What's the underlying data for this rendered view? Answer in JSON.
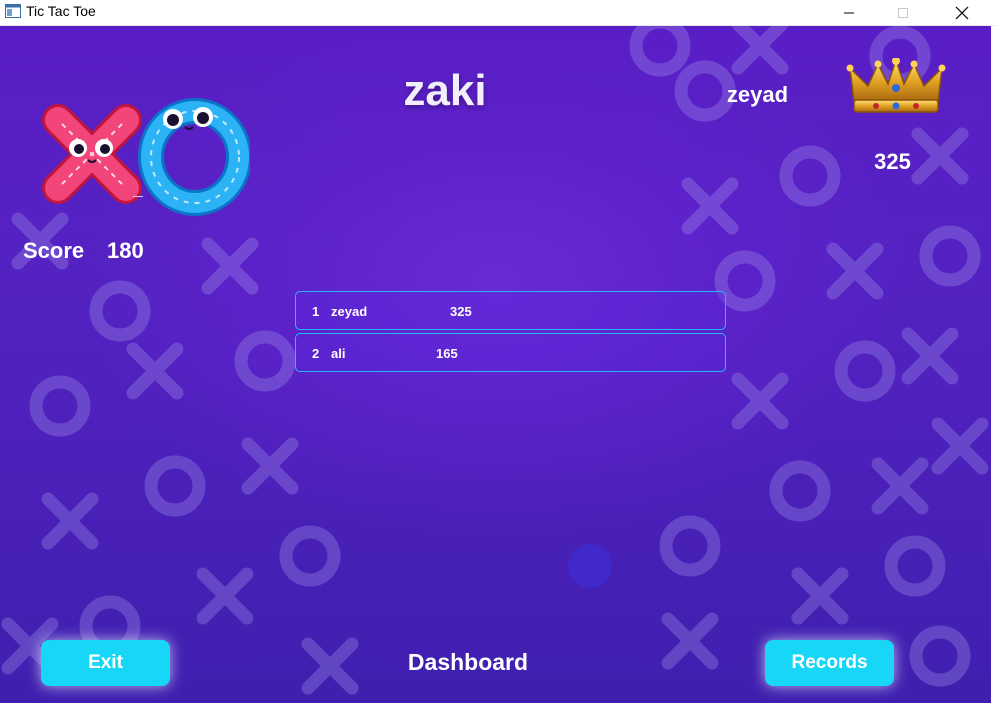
{
  "window": {
    "title": "Tic Tac Toe"
  },
  "player": {
    "name": "zaki",
    "score_label": "Score",
    "score": "180"
  },
  "top_player": {
    "name": "zeyad",
    "score": "325"
  },
  "leaderboard": [
    {
      "rank": "1",
      "name": "zeyad",
      "score": "325"
    },
    {
      "rank": "2",
      "name": "ali",
      "score": "165"
    }
  ],
  "footer": {
    "exit_label": "Exit",
    "title": "Dashboard",
    "records_label": "Records"
  },
  "colors": {
    "accent": "#18d6f6",
    "row_border": "#27b6ff",
    "background": "#5a1ec6"
  },
  "icons": {
    "logo": "xo-logo-icon",
    "crown": "crown-icon"
  }
}
